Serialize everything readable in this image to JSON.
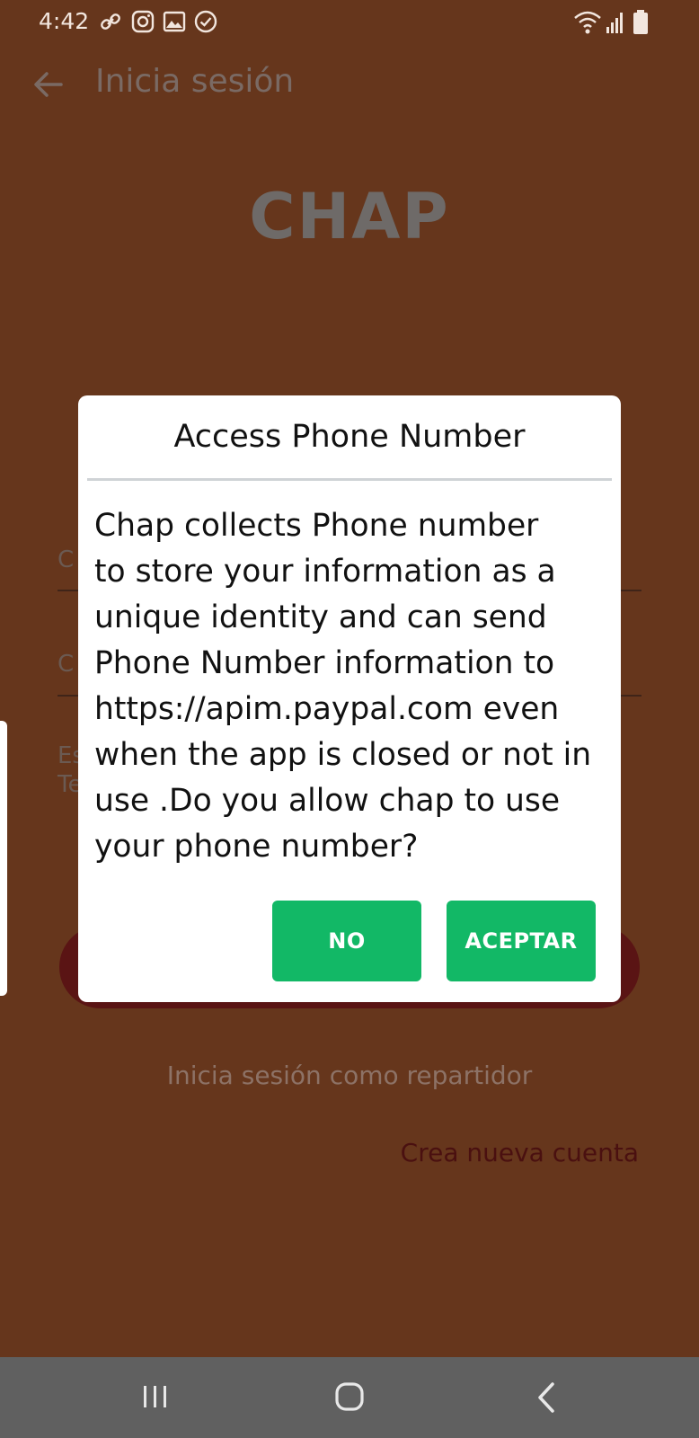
{
  "status_bar": {
    "time": "4:42",
    "icons": [
      "link-icon",
      "instagram-icon",
      "image-icon",
      "check-circle-icon"
    ],
    "right_icons": [
      "wifi-icon",
      "signal-icon",
      "battery-icon"
    ]
  },
  "app_bar": {
    "title": "Inicia sesión",
    "back_icon": "arrow-left-icon"
  },
  "logo": {
    "text": "CHAP"
  },
  "form": {
    "field1_hint": "C",
    "field2_hint": "C",
    "helper_line1": "Es",
    "helper_line2": "Te"
  },
  "links": {
    "driver_login": "Inicia sesión como repartidor",
    "create_account": "Crea nueva cuenta"
  },
  "dialog": {
    "title": "Access Phone Number",
    "message": "Chap collects Phone number\nto store your information as a\nunique identity and can send\nPhone Number information to\nhttps://apim.paypal.com even\nwhen the app is closed or not in\nuse .Do you allow chap to use\nyour phone number?",
    "no_label": "NO",
    "accept_label": "ACEPTAR"
  },
  "nav_bar": {
    "icons": [
      "recent-apps-icon",
      "home-icon",
      "back-icon"
    ]
  },
  "colors": {
    "background": "#66361c",
    "dialog_button": "#12b866",
    "navbar": "#606060"
  }
}
